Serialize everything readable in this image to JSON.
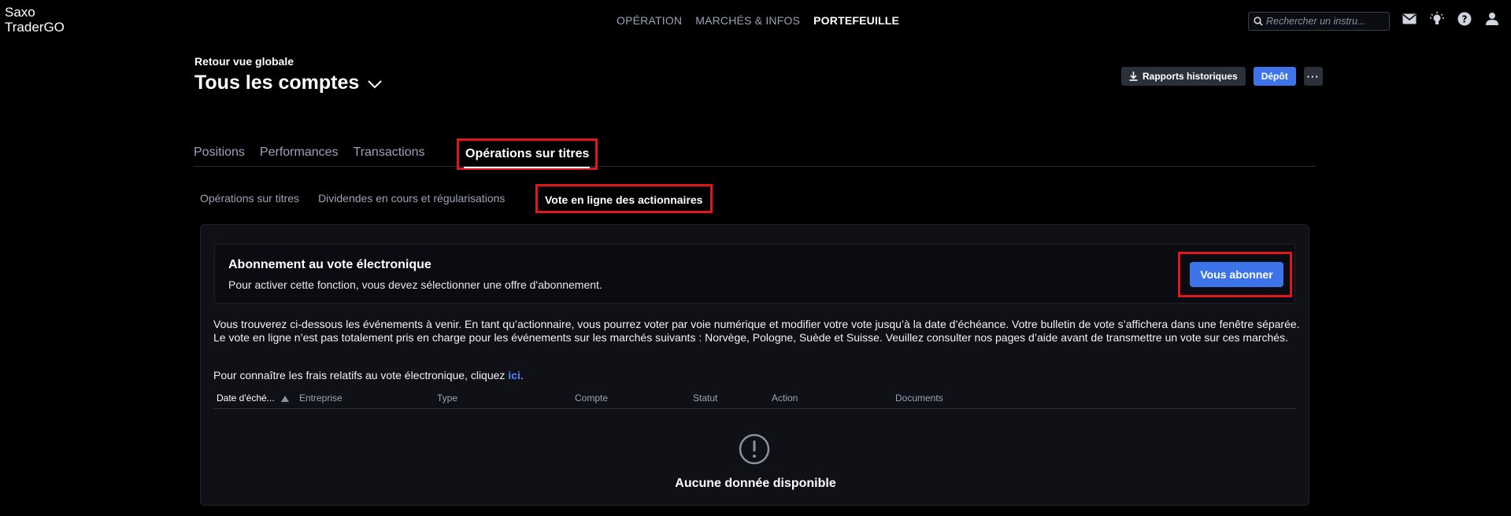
{
  "app": {
    "logo_line1": "Saxo",
    "logo_line2": "TraderGO"
  },
  "topnav": {
    "items": [
      "OPÉRATION",
      "MARCHÉS & INFOS",
      "PORTEFEUILLE"
    ],
    "active": "PORTEFEUILLE"
  },
  "search": {
    "placeholder": "Rechercher un instru..."
  },
  "topicons": [
    "search-icon",
    "mail-icon",
    "lightbulb-icon",
    "help-icon",
    "user-icon"
  ],
  "header": {
    "back_label": "Retour vue globale",
    "account_title": "Tous les comptes",
    "reports_label": "Rapports historiques",
    "deposit_label": "Dépôt",
    "more_label": "···"
  },
  "tabs": {
    "items": [
      "Positions",
      "Performances",
      "Transactions"
    ],
    "active": "Opérations sur titres"
  },
  "subtabs": {
    "items": [
      "Opérations sur titres",
      "Dividendes en cours et régularisations"
    ],
    "active": "Vote en ligne des actionnaires"
  },
  "subscription": {
    "title": "Abonnement au vote électronique",
    "text": "Pour activer cette fonction, vous devez sélectionner une offre d'abonnement.",
    "button": "Vous abonner"
  },
  "info": {
    "paragraph": "Vous trouverez ci-dessous les événements à venir. En tant qu’actionnaire, vous pourrez voter par voie numérique et modifier votre vote jusqu’à la date d’échéance. Votre bulletin de vote s’affichera dans une fenêtre séparée. Le vote en ligne n’est pas totalement pris en charge pour les événements sur les marchés suivants : Norvège, Pologne, Suède et Suisse. Veuillez consulter nos pages d’aide avant de transmettre un vote sur ces marchés.",
    "fees_prefix": "Pour connaître les frais relatifs au vote électronique, cliquez ",
    "fees_link": "ici",
    "fees_suffix": "."
  },
  "table": {
    "columns": [
      "Date d'éché...",
      "Entreprise",
      "Type",
      "Compte",
      "Statut",
      "Action",
      "Documents"
    ],
    "sorted_column": "Date d'éché...",
    "sort_direction": "ascending",
    "rows": []
  },
  "empty": {
    "text": "Aucune donnée disponible"
  },
  "colors": {
    "accent": "#3d74e9",
    "highlight": "#e0161e",
    "background": "#000000"
  }
}
